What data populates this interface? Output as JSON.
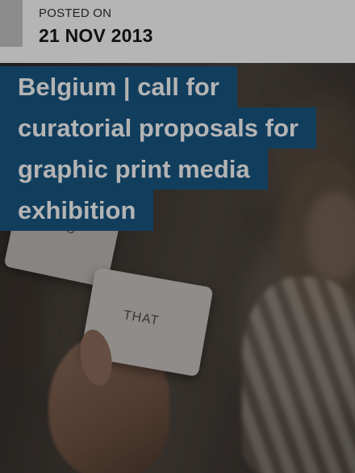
{
  "post": {
    "posted_on_label": "POSTED ON",
    "date": "21 NOV 2013",
    "title_lines": [
      "Belgium | call for",
      "curatorial proposals for",
      "graphic print media",
      "exhibition"
    ]
  },
  "image": {
    "card_left_text": "THIS",
    "card_right_text": "THAT"
  },
  "colors": {
    "title_background": "#123e5e",
    "title_text": "#b4b4b4",
    "date_bar": "#b5b5b5"
  }
}
